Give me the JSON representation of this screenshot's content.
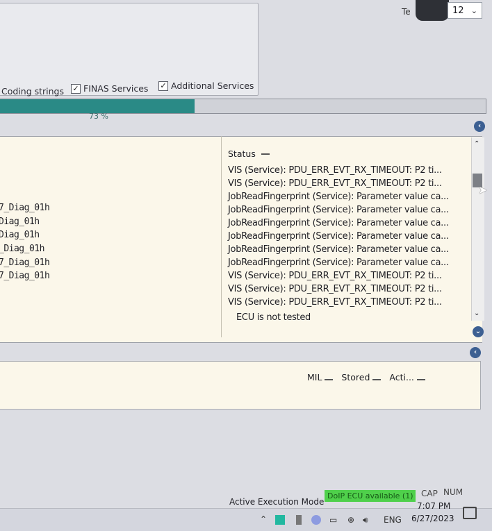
{
  "options": {
    "coding_strings": {
      "label": "Coding strings"
    },
    "finas_services": {
      "label": "FINAS Services",
      "checked": true
    },
    "additional_services": {
      "label": "Additional Services",
      "checked": true
    }
  },
  "text_size": {
    "label": "Te",
    "value": "12"
  },
  "progress": {
    "percent": 73,
    "label": "73 %"
  },
  "ecu_list": {
    "status_header": "Status",
    "ecu_names": [
      "7_Diag_01h",
      "Diag_01h",
      "Diag_01h",
      "_Diag_01h",
      "7_Diag_01h",
      "7_Diag_01h"
    ],
    "status_rows": [
      "VIS (Service): PDU_ERR_EVT_RX_TIMEOUT: P2 ti...",
      "VIS (Service): PDU_ERR_EVT_RX_TIMEOUT: P2 ti...",
      "JobReadFingerprint (Service): Parameter value ca...",
      "JobReadFingerprint (Service): Parameter value ca...",
      "JobReadFingerprint (Service): Parameter value ca...",
      "JobReadFingerprint (Service): Parameter value ca...",
      "JobReadFingerprint (Service): Parameter value ca...",
      "JobReadFingerprint (Service): Parameter value ca...",
      "VIS (Service): PDU_ERR_EVT_RX_TIMEOUT: P2 ti...",
      "VIS (Service): PDU_ERR_EVT_RX_TIMEOUT: P2 ti...",
      "VIS (Service): PDU_ERR_EVT_RX_TIMEOUT: P2 ti...",
      "ECU is not tested"
    ]
  },
  "faults": {
    "columns": [
      "MIL",
      "Stored",
      "Acti..."
    ]
  },
  "statusbar": {
    "execution_mode": "Active Execution Mode",
    "doip": "DoIP ECU available (1)",
    "cap": "CAP",
    "num": "NUM"
  },
  "taskbar": {
    "language": "ENG",
    "time": "7:07 PM",
    "date": "6/27/2023"
  },
  "colors": {
    "progress": "#2a8a86",
    "doip_badge": "#4fd04b",
    "nav_button": "#3c5f92"
  }
}
